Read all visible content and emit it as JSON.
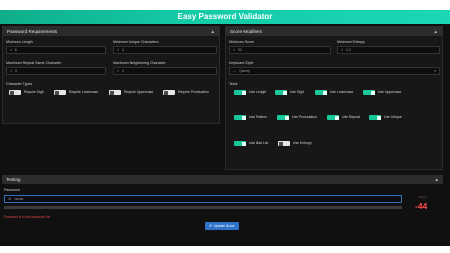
{
  "app": {
    "title": "Easy Password Validator"
  },
  "requirements": {
    "header": "Password Requirements",
    "min_length": {
      "label": "Minimum Length",
      "value": "6"
    },
    "min_unique": {
      "label": "Minimum Unique Characters",
      "value": "4"
    },
    "max_repeat": {
      "label": "Maximum Repeat Same Character",
      "value": "3"
    },
    "max_neighbor": {
      "label": "Maximum Neighboring Character",
      "value": "4"
    },
    "char_types_label": "Character Types",
    "char_types": [
      {
        "label": "Require Digit",
        "on": false
      },
      {
        "label": "Require Lowercase",
        "on": false
      },
      {
        "label": "Require Uppercase",
        "on": false
      },
      {
        "label": "Require Punctuation",
        "on": false
      }
    ]
  },
  "modifiers": {
    "header": "Score Modifiers",
    "min_score": {
      "label": "Minimum Score",
      "value": "90"
    },
    "min_entropy": {
      "label": "Minimum Entropy",
      "value": "2.0"
    },
    "keyboard_style": {
      "label": "Keyboard Style",
      "value": "Qwerty"
    },
    "tests_label": "Tests",
    "tests": [
      {
        "label": "Use Length",
        "on": true
      },
      {
        "label": "Use Digit",
        "on": true
      },
      {
        "label": "Use Lowercase",
        "on": true
      },
      {
        "label": "Use Uppercase",
        "on": true
      },
      {
        "label": "Use Pattern",
        "on": true
      },
      {
        "label": "Use Punctuation",
        "on": true
      },
      {
        "label": "Use Repeat",
        "on": true
      },
      {
        "label": "Use Unique",
        "on": true
      },
      {
        "label": "Use Bad List",
        "on": true
      },
      {
        "label": "Use Entropy",
        "on": false
      }
    ]
  },
  "testing": {
    "header": "Testing",
    "password_label": "Password",
    "password_value": "•••••••",
    "error": "Password is in bad password list",
    "score_label": "Score",
    "score_value": "-44",
    "update_button": "Update Score"
  },
  "colors": {
    "accent": "#16c79a",
    "error": "#e04848",
    "button": "#2f73c9",
    "score": "#ff4b4b"
  }
}
